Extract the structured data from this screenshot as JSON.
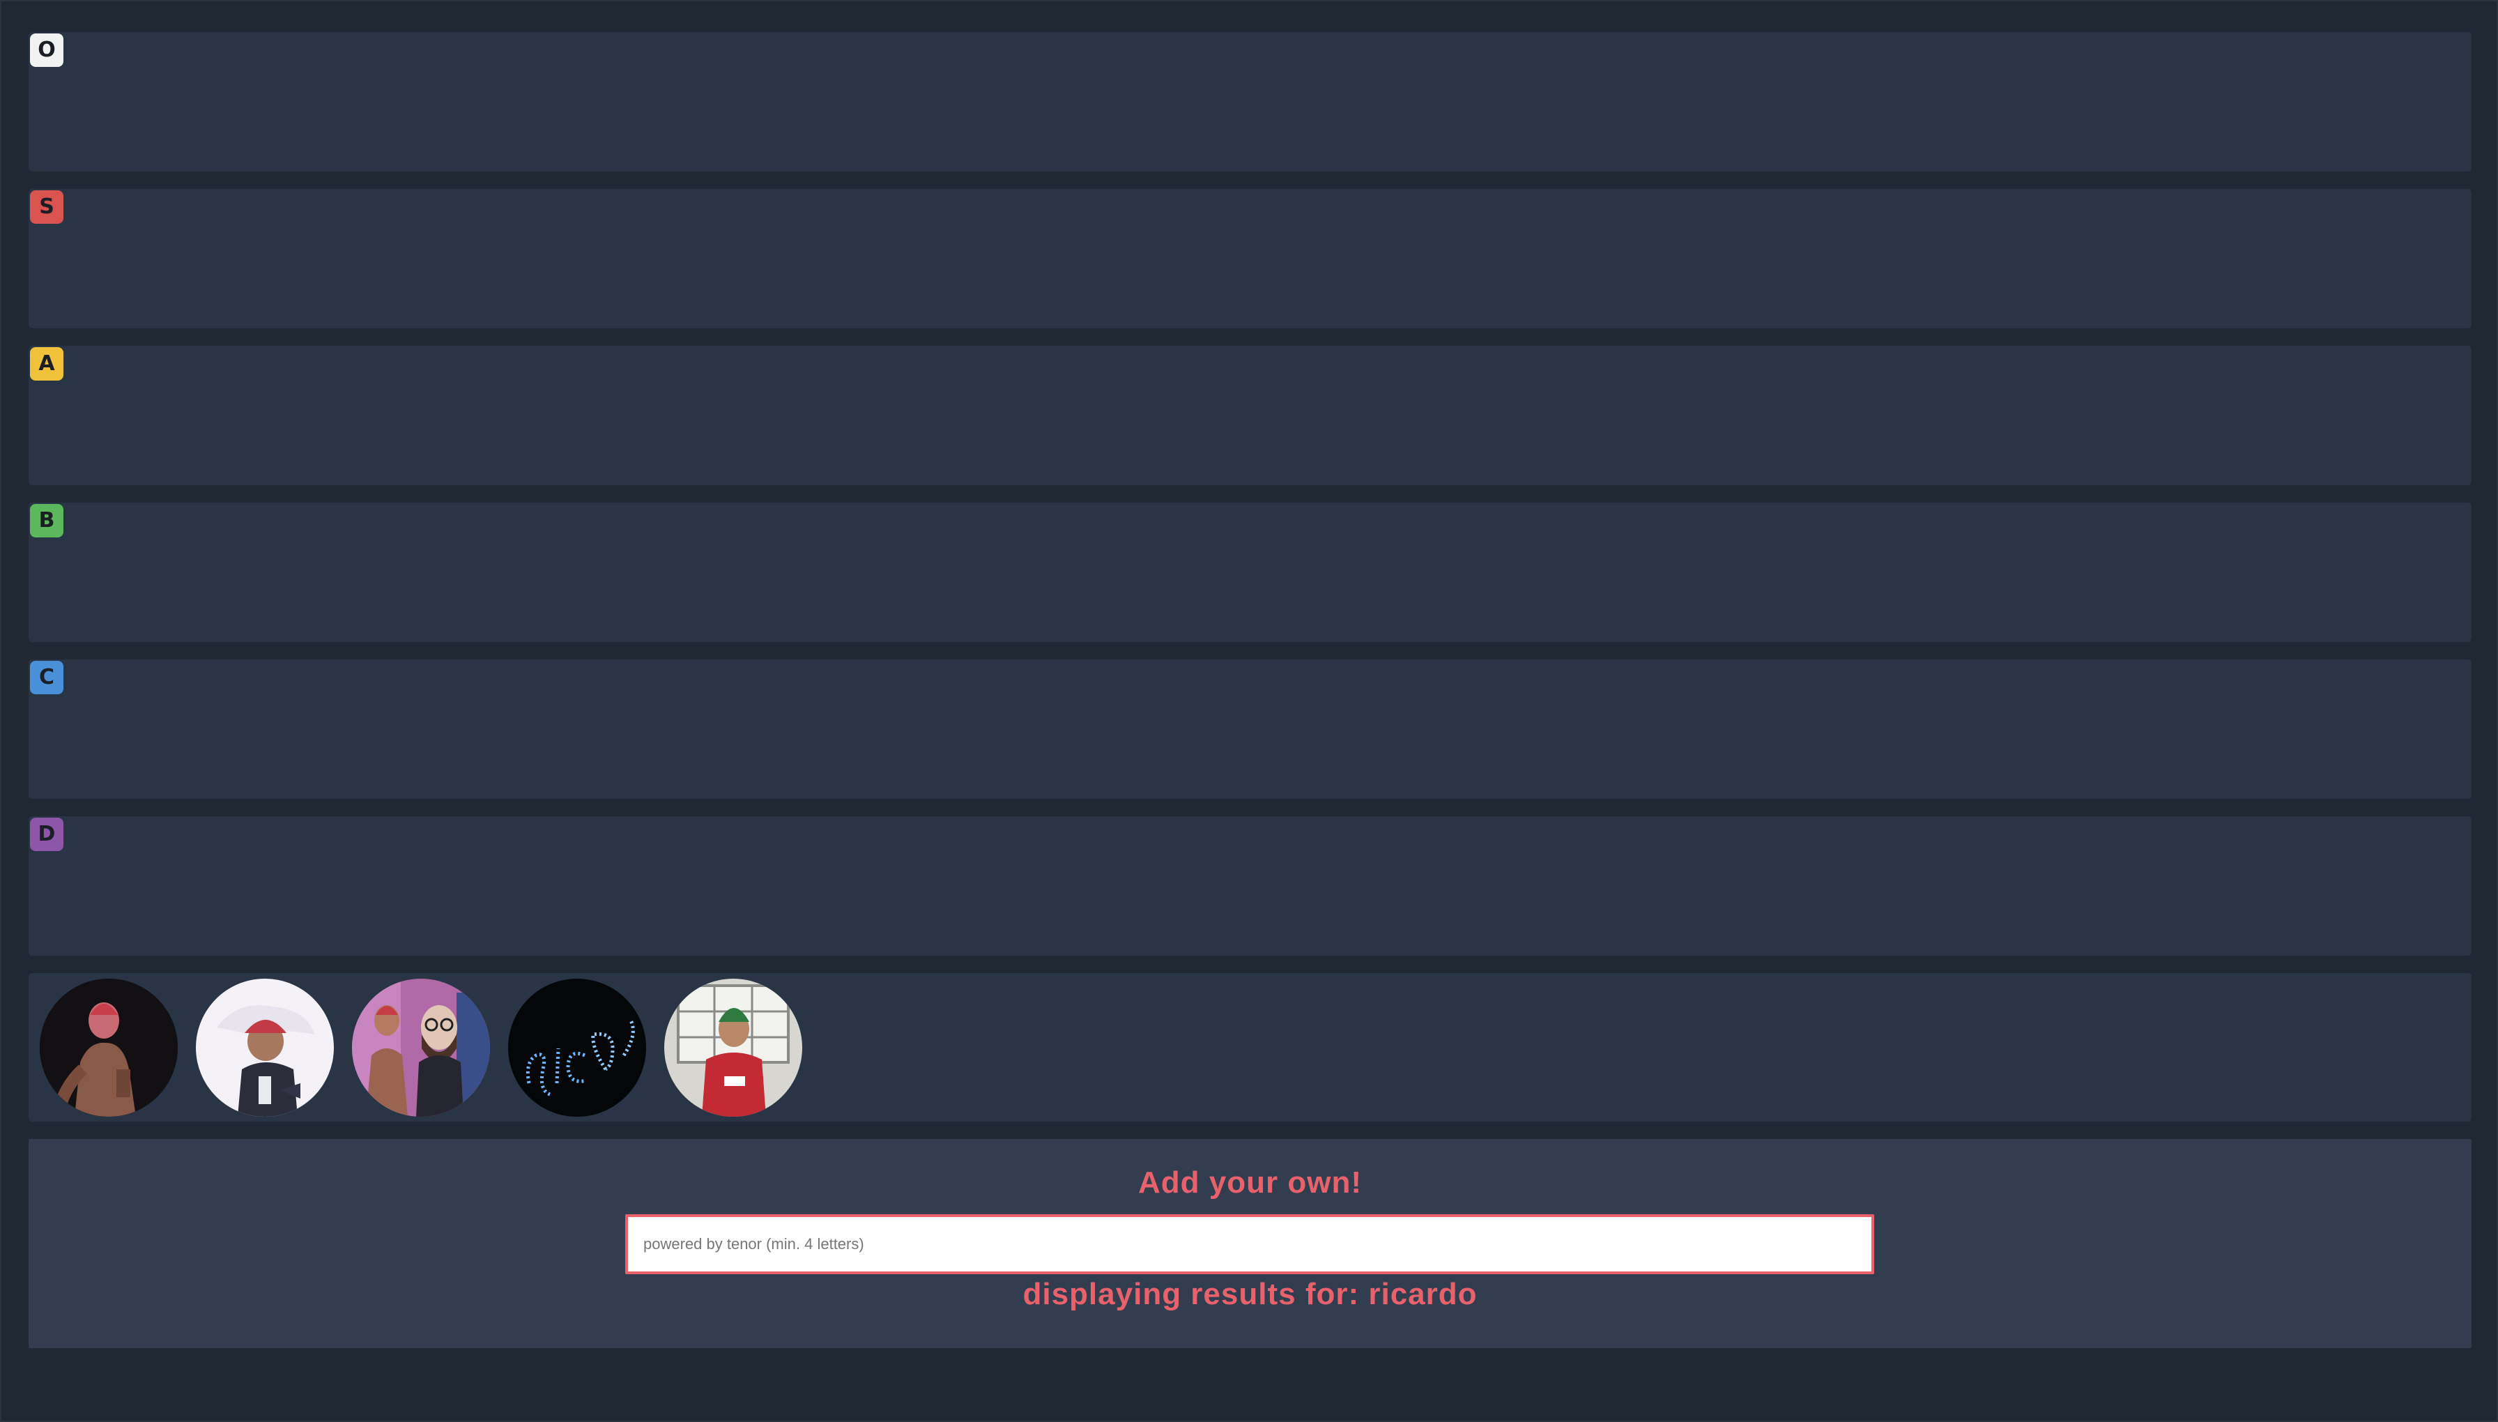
{
  "tiers": [
    {
      "label": "O",
      "color": "#f2f2f2"
    },
    {
      "label": "S",
      "color": "#d9534f"
    },
    {
      "label": "A",
      "color": "#f0c13a"
    },
    {
      "label": "B",
      "color": "#5cb85c"
    },
    {
      "label": "C",
      "color": "#4a90d9"
    },
    {
      "label": "D",
      "color": "#8e56a8"
    }
  ],
  "pool": {
    "items": [
      {
        "icon": "ricardo-gif-1"
      },
      {
        "icon": "ricardo-gif-2"
      },
      {
        "icon": "ricardo-gif-3"
      },
      {
        "icon": "ricardo-gif-4"
      },
      {
        "icon": "ricardo-gif-5"
      }
    ]
  },
  "add_panel": {
    "title": "Add your own!",
    "search_placeholder": "powered by tenor (min. 4 letters)",
    "search_value": "",
    "results_text": "displaying results for: ricardo"
  },
  "colors": {
    "accent": "#e8616b",
    "background": "#1f2833",
    "row": "#293545",
    "panel": "#323e50"
  }
}
